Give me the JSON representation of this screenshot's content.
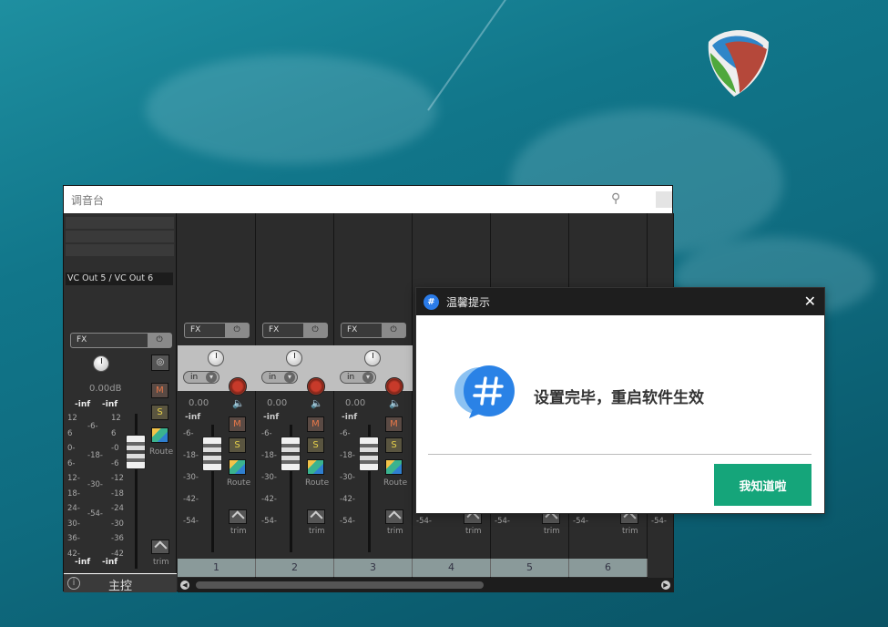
{
  "mixer": {
    "title": "调音台",
    "master": {
      "io_label": "VC Out 5 / VC Out 6",
      "fx_label": "FX",
      "db": "0.00dB",
      "inf_top_left": "-inf",
      "inf_top_right": "-inf",
      "inf_bottom_left": "-inf",
      "inf_bottom_right": "-inf",
      "scale_left": [
        "12",
        "6",
        "0-",
        "6-",
        "12-",
        "18-",
        "24-",
        "30-",
        "36-",
        "42-"
      ],
      "scale_mid": [
        "-6-",
        "-18-",
        "-30-",
        "-54-"
      ],
      "scale_right": [
        "12",
        "6",
        "-0",
        "-6",
        "-12",
        "-18",
        "-24",
        "-30",
        "-36",
        "-42"
      ],
      "mute": "M",
      "solo": "S",
      "route": "Route",
      "trim": "trim",
      "label": "主控",
      "info": "i"
    },
    "track_common": {
      "fx_label": "FX",
      "input": "in",
      "db": "0.00",
      "inf": "-inf",
      "scale": [
        "-6-",
        "-18-",
        "-30-",
        "-42-",
        "-54-"
      ],
      "mute": "M",
      "solo": "S",
      "route": "Route",
      "trim": "trim",
      "partial_scale": "-54-"
    },
    "tracks": [
      "1",
      "2",
      "3",
      "4",
      "5",
      "6"
    ]
  },
  "dialog": {
    "title": "温馨提示",
    "message": "设置完毕，重启软件生效",
    "ok_label": "我知道啦",
    "close": "✕"
  }
}
